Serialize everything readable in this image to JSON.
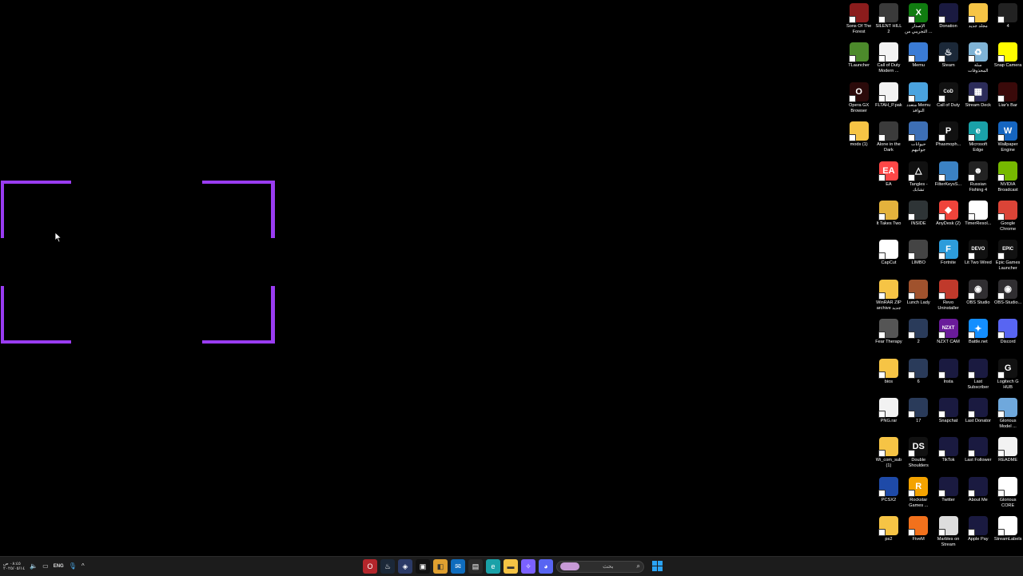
{
  "desktop": {
    "colors": {
      "frame": "#9a3cf2",
      "background": "#000000"
    },
    "icons": [
      {
        "label": "Sons Of The Forest",
        "icon": "game-icon",
        "color": "#8b1c1c",
        "glyph": ""
      },
      {
        "label": "SILENT HILL 2",
        "icon": "game-icon",
        "color": "#3a3a3a",
        "glyph": ""
      },
      {
        "label": "الإصدار التجريبي من ...",
        "icon": "xbox-icon",
        "color": "#107c10",
        "glyph": "X"
      },
      {
        "label": "Donation",
        "icon": "blank-icon",
        "color": "#1a1a40",
        "glyph": ""
      },
      {
        "label": "مجلد جديد",
        "icon": "folder-icon",
        "color": "#f6c445",
        "glyph": ""
      },
      {
        "label": "4",
        "icon": "video-icon",
        "color": "#222",
        "glyph": ""
      },
      {
        "label": "TLauncher",
        "icon": "tlauncher-icon",
        "color": "#4c8a2b",
        "glyph": ""
      },
      {
        "label": "Call of Duty Modern ...",
        "icon": "file-icon",
        "color": "#f2f2f2",
        "glyph": ""
      },
      {
        "label": "Memu",
        "icon": "memu-icon",
        "color": "#3a7bd5",
        "glyph": ""
      },
      {
        "label": "Steam",
        "icon": "steam-icon",
        "color": "#1b2838",
        "glyph": "♨"
      },
      {
        "label": "سلة المحذوفات",
        "icon": "recycle-bin-icon",
        "color": "#7fb3d5",
        "glyph": "♻"
      },
      {
        "label": "Snap Camera",
        "icon": "snap-camera-icon",
        "color": "#fffc00",
        "glyph": ""
      },
      {
        "label": "Opera GX Browser",
        "icon": "opera-gx-icon",
        "color": "#2b0a0a",
        "glyph": "O"
      },
      {
        "label": "FLTAH_P.pak",
        "icon": "file-icon",
        "color": "#f2f2f2",
        "glyph": ""
      },
      {
        "label": "متعدد Memu النوافذ",
        "icon": "memu-multi-icon",
        "color": "#4aa3df",
        "glyph": ""
      },
      {
        "label": "Call of Duty",
        "icon": "cod-icon",
        "color": "#111",
        "glyph": "CoD"
      },
      {
        "label": "Stream Deck",
        "icon": "stream-deck-icon",
        "color": "#2c2c5a",
        "glyph": "▦"
      },
      {
        "label": "Liar's Bar",
        "icon": "game-icon",
        "color": "#3a0a0a",
        "glyph": ""
      },
      {
        "label": "mods (1)",
        "icon": "folder-icon",
        "color": "#f6c445",
        "glyph": ""
      },
      {
        "label": "Alone in the Dark",
        "icon": "game-icon",
        "color": "#3b3b3b",
        "glyph": ""
      },
      {
        "label": "حيوانات جوانيهم",
        "icon": "game-icon",
        "color": "#3d6fb5",
        "glyph": ""
      },
      {
        "label": "Phasmoph...",
        "icon": "phasmophobia-icon",
        "color": "#111",
        "glyph": "P"
      },
      {
        "label": "Microsoft Edge",
        "icon": "edge-icon",
        "color": "#1aa1a8",
        "glyph": "e"
      },
      {
        "label": "Wallpaper Engine",
        "icon": "wallpaper-engine-icon",
        "color": "#1565c0",
        "glyph": "W"
      },
      {
        "label": "",
        "icon": "empty",
        "color": "",
        "glyph": ""
      },
      {
        "label": "EA",
        "icon": "ea-icon",
        "color": "#ff4747",
        "glyph": "EA"
      },
      {
        "label": "Tangles - تشابك",
        "icon": "tangles-icon",
        "color": "#111",
        "glyph": "△"
      },
      {
        "label": "FilterKeysS...",
        "icon": "app-icon",
        "color": "#3b82c4",
        "glyph": ""
      },
      {
        "label": "Russian Fishing 4",
        "icon": "game-icon",
        "color": "#222",
        "glyph": "☻"
      },
      {
        "label": "NVIDIA Broadcast",
        "icon": "nvidia-icon",
        "color": "#76b900",
        "glyph": ""
      },
      {
        "label": "",
        "icon": "empty",
        "color": "",
        "glyph": ""
      },
      {
        "label": "It Takes Two",
        "icon": "game-icon",
        "color": "#e3b23c",
        "glyph": ""
      },
      {
        "label": "INSIDE",
        "icon": "game-icon",
        "color": "#2e3436",
        "glyph": ""
      },
      {
        "label": "AnyDesk (2)",
        "icon": "anydesk-icon",
        "color": "#ef443b",
        "glyph": "◆"
      },
      {
        "label": "TimerResol...",
        "icon": "clock-icon",
        "color": "#fff",
        "glyph": ""
      },
      {
        "label": "Google Chrome",
        "icon": "chrome-icon",
        "color": "#db4437",
        "glyph": ""
      },
      {
        "label": "",
        "icon": "empty",
        "color": "",
        "glyph": ""
      },
      {
        "label": "CapCut",
        "icon": "capcut-icon",
        "color": "#fff",
        "glyph": ""
      },
      {
        "label": "LIMBO",
        "icon": "game-icon",
        "color": "#444",
        "glyph": ""
      },
      {
        "label": "Fortnite",
        "icon": "fortnite-icon",
        "color": "#2d9cdb",
        "glyph": "F"
      },
      {
        "label": "Lit Two Wired",
        "icon": "devo-icon",
        "color": "#111",
        "glyph": "DEVO"
      },
      {
        "label": "Epic Games Launcher",
        "icon": "epic-games-icon",
        "color": "#111",
        "glyph": "EPIC"
      },
      {
        "label": "",
        "icon": "empty",
        "color": "",
        "glyph": ""
      },
      {
        "label": "WinRAR ZIP archive جديد",
        "icon": "winrar-icon",
        "color": "#f6c445",
        "glyph": ""
      },
      {
        "label": "Lunch Lady",
        "icon": "game-icon",
        "color": "#a0522d",
        "glyph": ""
      },
      {
        "label": "Revo Uninstaller",
        "icon": "revo-icon",
        "color": "#c0392b",
        "glyph": ""
      },
      {
        "label": "OBS Studio",
        "icon": "obs-icon",
        "color": "#302e31",
        "glyph": "◉"
      },
      {
        "label": "OBS-Studio...",
        "icon": "obs-icon",
        "color": "#302e31",
        "glyph": "◉"
      },
      {
        "label": "",
        "icon": "empty",
        "color": "",
        "glyph": ""
      },
      {
        "label": "Fear Therapy",
        "icon": "game-icon",
        "color": "#555",
        "glyph": ""
      },
      {
        "label": "2",
        "icon": "video-icon",
        "color": "#2a3b5a",
        "glyph": ""
      },
      {
        "label": "NZXT CAM",
        "icon": "nzxt-icon",
        "color": "#6a1b9a",
        "glyph": "NZXT"
      },
      {
        "label": "Battle.net",
        "icon": "battlenet-icon",
        "color": "#148eff",
        "glyph": "✦"
      },
      {
        "label": "Discord",
        "icon": "discord-icon",
        "color": "#5865f2",
        "glyph": ""
      },
      {
        "label": "",
        "icon": "empty",
        "color": "",
        "glyph": ""
      },
      {
        "label": "bios",
        "icon": "folder-icon",
        "color": "#f6c445",
        "glyph": ""
      },
      {
        "label": "6",
        "icon": "video-icon",
        "color": "#2a3b5a",
        "glyph": ""
      },
      {
        "label": "Insta",
        "icon": "blank-icon",
        "color": "#1a1a40",
        "glyph": ""
      },
      {
        "label": "Last Subscriber",
        "icon": "blank-icon",
        "color": "#1a1a40",
        "glyph": ""
      },
      {
        "label": "Logitech G HUB",
        "icon": "logitech-icon",
        "color": "#111",
        "glyph": "G"
      },
      {
        "label": "",
        "icon": "empty",
        "color": "",
        "glyph": ""
      },
      {
        "label": "PNG.rar",
        "icon": "file-icon",
        "color": "#f2f2f2",
        "glyph": ""
      },
      {
        "label": "17",
        "icon": "video-icon",
        "color": "#2a3b5a",
        "glyph": ""
      },
      {
        "label": "Snapchat",
        "icon": "blank-icon",
        "color": "#1a1a40",
        "glyph": ""
      },
      {
        "label": "Last Donator",
        "icon": "blank-icon",
        "color": "#1a1a40",
        "glyph": ""
      },
      {
        "label": "Glorious Model ...",
        "icon": "glorious-icon",
        "color": "#6fa8dc",
        "glyph": ""
      },
      {
        "label": "",
        "icon": "empty",
        "color": "",
        "glyph": ""
      },
      {
        "label": "Wi_com_sub (1)",
        "icon": "folder-icon",
        "color": "#f6c445",
        "glyph": ""
      },
      {
        "label": "Double Shoulders",
        "icon": "ds-icon",
        "color": "#111",
        "glyph": "DS"
      },
      {
        "label": "TikTok",
        "icon": "blank-icon",
        "color": "#1a1a40",
        "glyph": ""
      },
      {
        "label": "Last Follower",
        "icon": "blank-icon",
        "color": "#1a1a40",
        "glyph": ""
      },
      {
        "label": "README",
        "icon": "file-icon",
        "color": "#f2f2f2",
        "glyph": ""
      },
      {
        "label": "",
        "icon": "empty",
        "color": "",
        "glyph": ""
      },
      {
        "label": "PCSX2",
        "icon": "pcsx2-icon",
        "color": "#1e4aa8",
        "glyph": ""
      },
      {
        "label": "Rockstar Games ...",
        "icon": "rockstar-icon",
        "color": "#f4a300",
        "glyph": "R"
      },
      {
        "label": "Twitter",
        "icon": "blank-icon",
        "color": "#1a1a40",
        "glyph": ""
      },
      {
        "label": "About Me",
        "icon": "blank-icon",
        "color": "#1a1a40",
        "glyph": ""
      },
      {
        "label": "Glorious CORE",
        "icon": "glorious-icon",
        "color": "#fff",
        "glyph": ""
      },
      {
        "label": "",
        "icon": "empty",
        "color": "",
        "glyph": ""
      },
      {
        "label": "ps2",
        "icon": "folder-icon",
        "color": "#f6c445",
        "glyph": ""
      },
      {
        "label": "FiveM",
        "icon": "fivem-icon",
        "color": "#f2711c",
        "glyph": ""
      },
      {
        "label": "Marbles on Stream",
        "icon": "marbles-icon",
        "color": "#ddd",
        "glyph": ""
      },
      {
        "label": "Apple Pay",
        "icon": "blank-icon",
        "color": "#1a1a40",
        "glyph": ""
      },
      {
        "label": "StreamLabels",
        "icon": "streamlabels-icon",
        "color": "#fff",
        "glyph": ""
      }
    ]
  },
  "taskbar": {
    "clock_time": "٠٨:٤٥ ص",
    "clock_date": "٢٠٢٥/٠٥/١٤",
    "language": "ENG",
    "search_placeholder": "بحث",
    "search_image_label": "",
    "apps": [
      {
        "name": "opera-gx-taskbar-icon",
        "color": "#b3262b",
        "glyph": "O"
      },
      {
        "name": "steam-taskbar-icon",
        "color": "#1b2838",
        "glyph": "♨"
      },
      {
        "name": "app-taskbar-icon",
        "color": "#2b3a67",
        "glyph": "◈"
      },
      {
        "name": "capcut-taskbar-icon",
        "color": "#111",
        "glyph": "▣"
      },
      {
        "name": "app-taskbar-icon",
        "color": "#e0a030",
        "glyph": "◧"
      },
      {
        "name": "mail-taskbar-icon",
        "color": "#0f6cbd",
        "glyph": "✉"
      },
      {
        "name": "store-taskbar-icon",
        "color": "#2a2a2a",
        "glyph": "▤"
      },
      {
        "name": "edge-taskbar-icon",
        "color": "#1aa1a8",
        "glyph": "e"
      },
      {
        "name": "file-explorer-taskbar-icon",
        "color": "#f6c445",
        "glyph": "▬"
      },
      {
        "name": "copilot-taskbar-icon",
        "color": "#7b61ff",
        "glyph": "✧"
      },
      {
        "name": "discord-taskbar-icon",
        "color": "#5865f2",
        "glyph": "◕"
      }
    ]
  }
}
